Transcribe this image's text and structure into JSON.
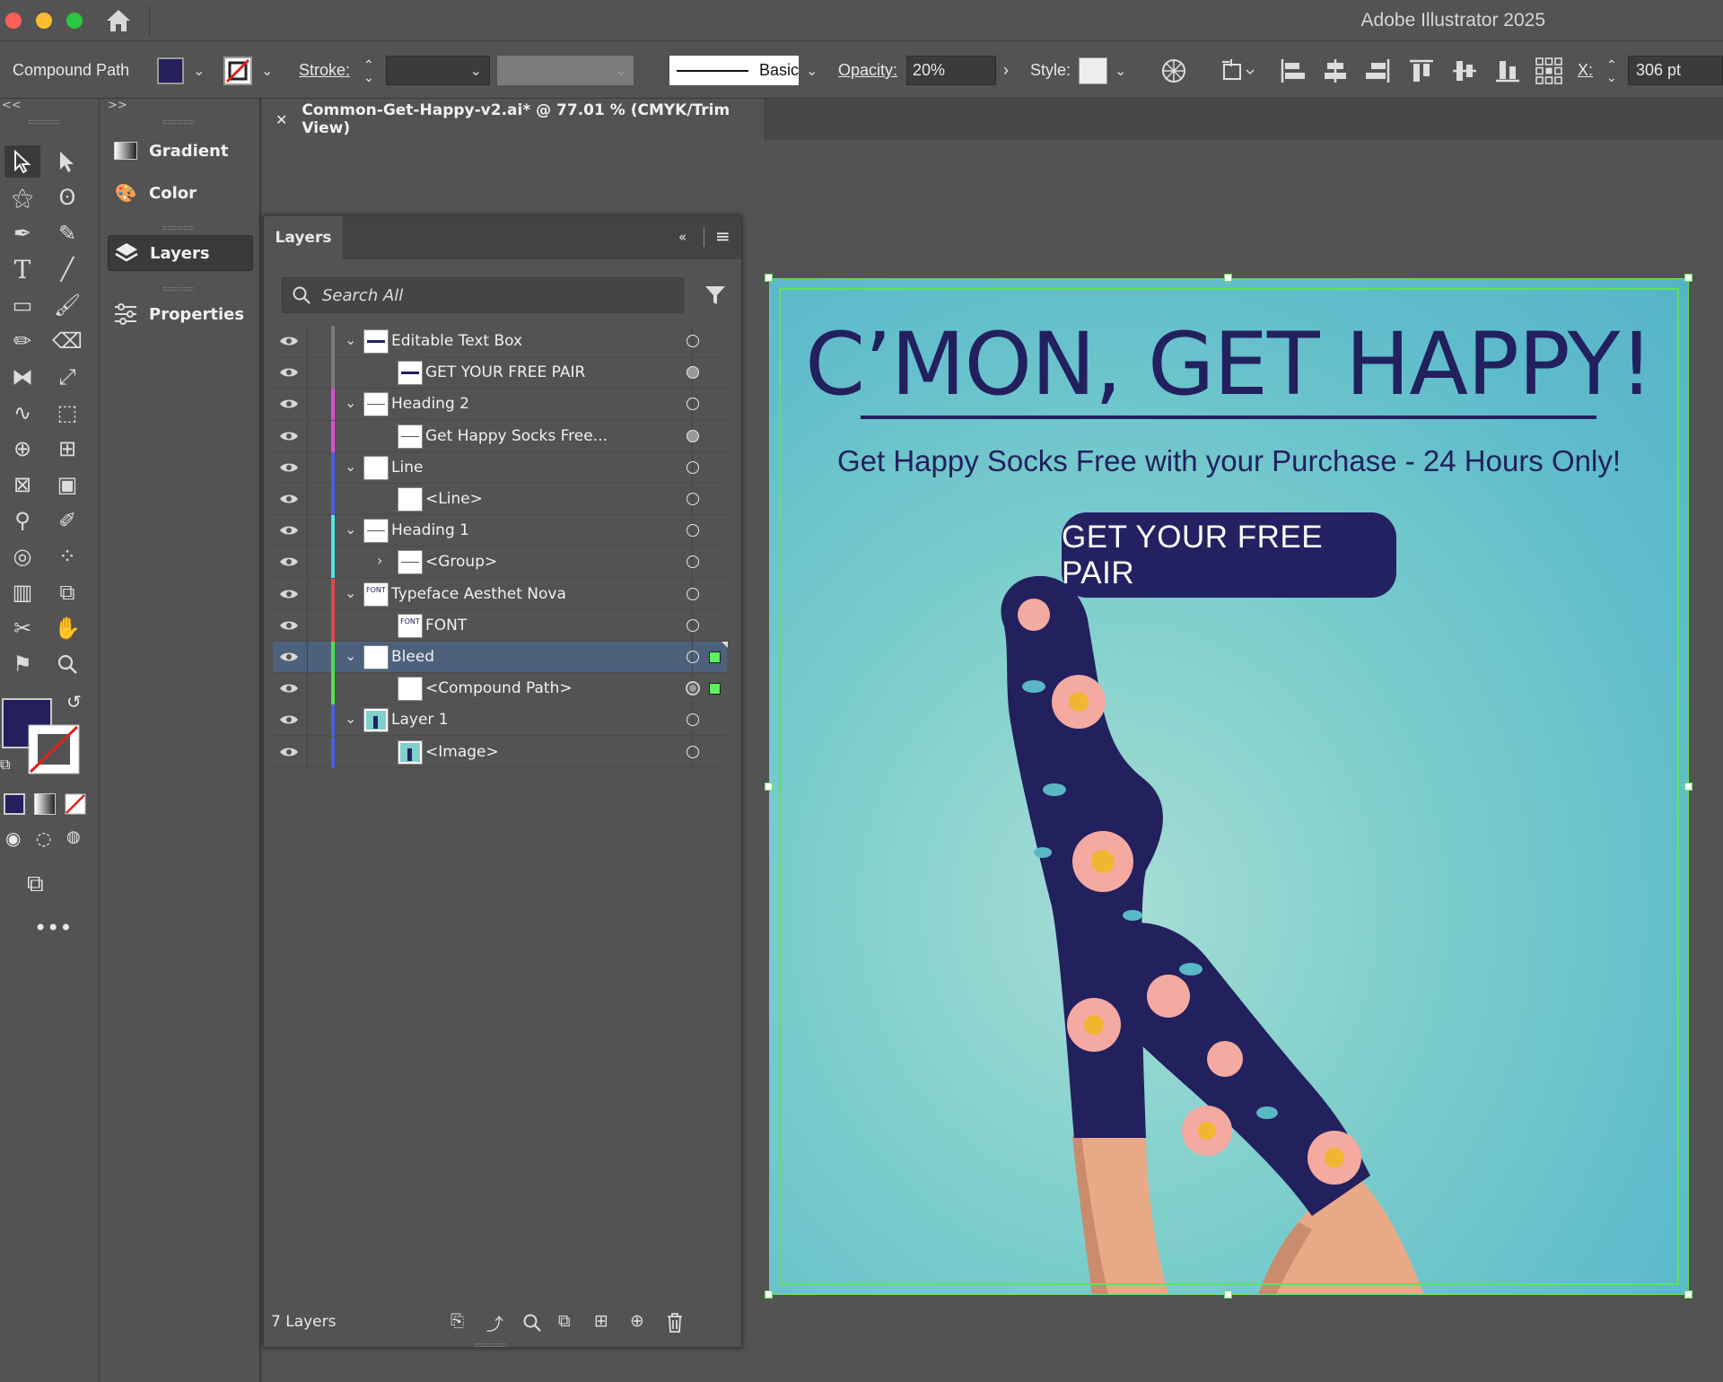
{
  "app": {
    "title": "Adobe Illustrator 2025"
  },
  "control_bar": {
    "object_type": "Compound Path",
    "stroke_label": "Stroke:",
    "brush_label": "Basic",
    "opacity_label": "Opacity:",
    "opacity_value": "20%",
    "style_label": "Style:",
    "x_label": "X:",
    "x_value": "306 pt",
    "fill_color": "#24205e"
  },
  "dock": {
    "collapse_left": "<<",
    "collapse_right": ">>",
    "items": [
      {
        "label": "Gradient",
        "icon": "gradient-icon"
      },
      {
        "label": "Color",
        "icon": "palette-icon"
      },
      {
        "label": "Layers",
        "icon": "layers-icon"
      },
      {
        "label": "Properties",
        "icon": "properties-icon"
      }
    ]
  },
  "document": {
    "tab_title": "Common-Get-Happy-v2.ai* @ 77.01 % (CMYK/Trim View)"
  },
  "layers_panel": {
    "tab": "Layers",
    "search_placeholder": "Search All",
    "footer_count": "7 Layers",
    "rows": [
      {
        "label": "Editable Text Box",
        "color": "#7a7a7a",
        "thumb": "text-box"
      },
      {
        "label": "GET YOUR FREE PAIR",
        "color": "#7a7a7a",
        "thumb": "text-box"
      },
      {
        "label": "Heading 2",
        "color": "#e04bd6",
        "thumb": "line"
      },
      {
        "label": "Get Happy Socks Free...",
        "color": "#e04bd6",
        "thumb": "line"
      },
      {
        "label": "Line",
        "color": "#4a5ee0",
        "thumb": "blank"
      },
      {
        "label": "<Line>",
        "color": "#4a5ee0",
        "thumb": "blank"
      },
      {
        "label": "Heading 1",
        "color": "#4fe6e6",
        "thumb": "line"
      },
      {
        "label": "<Group>",
        "color": "#4fe6e6",
        "thumb": "line"
      },
      {
        "label": "Typeface Aesthet Nova",
        "color": "#e04848",
        "thumb": "font",
        "thumb_text": "FONT"
      },
      {
        "label": "FONT",
        "color": "#e04848",
        "thumb": "font",
        "thumb_text": "FONT"
      },
      {
        "label": "Bleed",
        "color": "#4fe04f",
        "thumb": "blank"
      },
      {
        "label": "<Compound Path>",
        "color": "#4fe04f",
        "thumb": "blank"
      },
      {
        "label": "Layer 1",
        "color": "#4a5ee0",
        "thumb": "image"
      },
      {
        "label": "<Image>",
        "color": "#4a5ee0",
        "thumb": "image"
      }
    ]
  },
  "artboard": {
    "headline": "C’MON, GET HAPPY!",
    "subhead": "Get Happy Socks Free with your Purchase - 24 Hours Only!",
    "cta": "GET YOUR FREE PAIR",
    "accent": "#22205e",
    "bleed_color": "#5ee35e"
  }
}
